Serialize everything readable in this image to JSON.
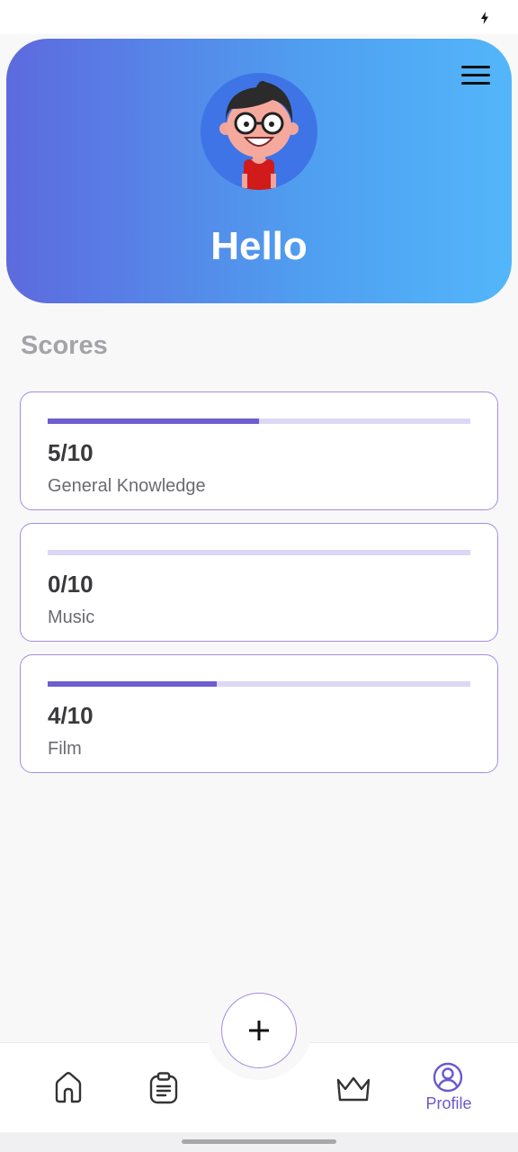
{
  "header": {
    "greeting": "Hello"
  },
  "scores": {
    "title": "Scores",
    "items": [
      {
        "score": "5/10",
        "category": "General Knowledge",
        "progress": 0.5
      },
      {
        "score": "0/10",
        "category": "Music",
        "progress": 0.0
      },
      {
        "score": "4/10",
        "category": "Film",
        "progress": 0.4
      }
    ]
  },
  "nav": {
    "profile_label": "Profile",
    "icons": [
      "home-icon",
      "clipboard-icon",
      "add-icon",
      "crown-icon",
      "profile-icon"
    ]
  },
  "colors": {
    "accent": "#6d5dd0",
    "track": "#dcd7f4",
    "gradient_start": "#5d6ade",
    "gradient_end": "#53b6fa"
  }
}
